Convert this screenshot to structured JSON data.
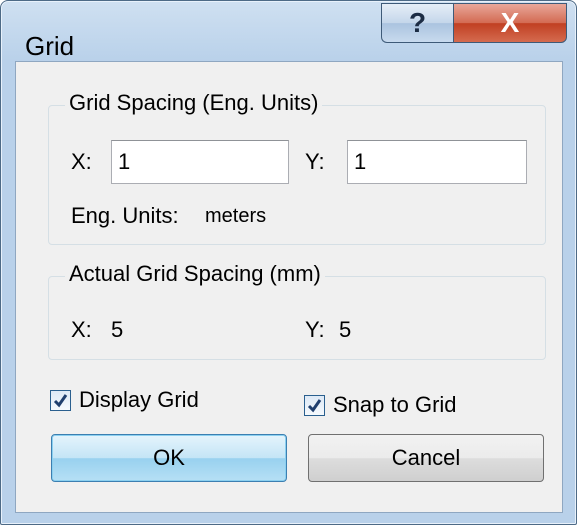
{
  "window": {
    "title": "Grid"
  },
  "titlebar": {
    "help_label": "?",
    "close_label": "X"
  },
  "grid_spacing": {
    "group_label": "Grid Spacing (Eng. Units)",
    "x_label": "X:",
    "x_value": "1",
    "y_label": "Y:",
    "y_value": "1",
    "units_label": "Eng. Units:",
    "units_value": "meters"
  },
  "actual_spacing": {
    "group_label": "Actual Grid Spacing (mm)",
    "x_label": "X:",
    "x_value": "5",
    "y_label": "Y:",
    "y_value": "5"
  },
  "options": {
    "display_grid_label": "Display Grid",
    "display_grid_checked": true,
    "snap_to_grid_label": "Snap to Grid",
    "snap_to_grid_checked": true
  },
  "buttons": {
    "ok_label": "OK",
    "cancel_label": "Cancel"
  }
}
